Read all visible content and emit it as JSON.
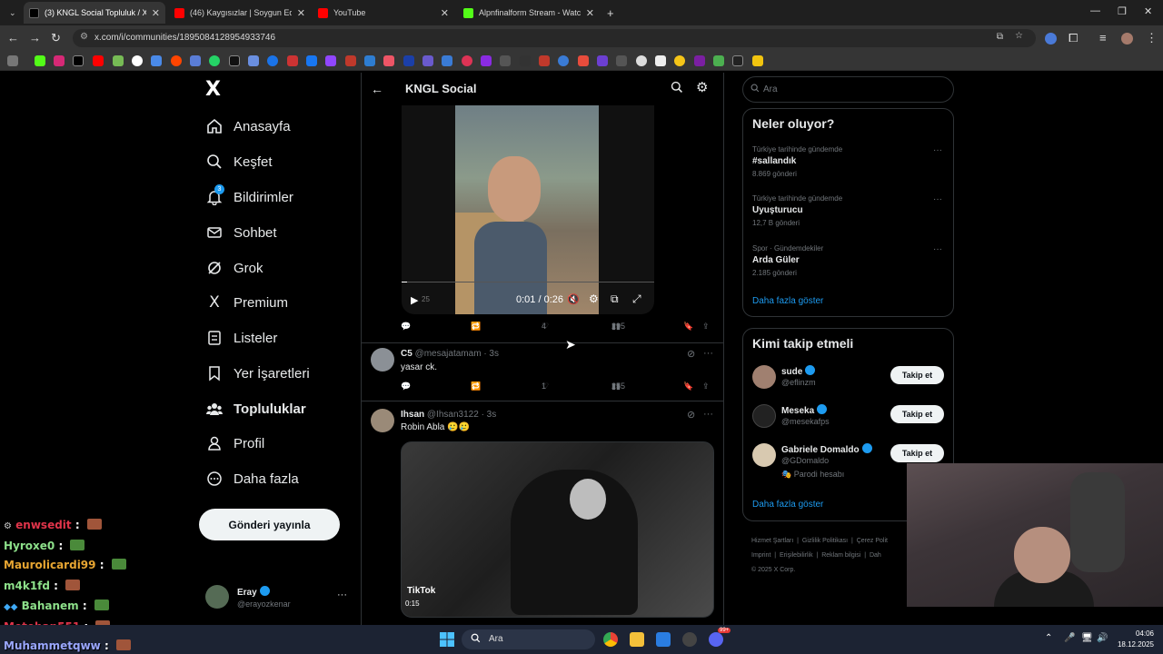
{
  "browser": {
    "tabs": [
      {
        "title": "(3) KNGL Social Topluluk / X",
        "active": true
      },
      {
        "title": "(46) Kaygısızlar | Soygun Edit - Y",
        "active": false
      },
      {
        "title": "YouTube",
        "active": false
      },
      {
        "title": "Alpnfinalform Stream - Watch L",
        "active": false
      }
    ],
    "url": "x.com/i/communities/1895084128954933746",
    "new_tab": "+"
  },
  "nav": {
    "logo": "X",
    "items": [
      {
        "label": "Anasayfa",
        "icon": "home-icon"
      },
      {
        "label": "Keşfet",
        "icon": "search-icon"
      },
      {
        "label": "Bildirimler",
        "icon": "bell-icon",
        "badge": "3"
      },
      {
        "label": "Sohbet",
        "icon": "mail-icon"
      },
      {
        "label": "Grok",
        "icon": "grok-icon"
      },
      {
        "label": "Premium",
        "icon": "x-premium-icon"
      },
      {
        "label": "Listeler",
        "icon": "list-icon"
      },
      {
        "label": "Yer İşaretleri",
        "icon": "bookmark-icon"
      },
      {
        "label": "Topluluklar",
        "icon": "communities-icon"
      },
      {
        "label": "Profil",
        "icon": "profile-icon"
      },
      {
        "label": "Daha fazla",
        "icon": "more-circle-icon"
      }
    ],
    "post_button": "Gönderi yayınla",
    "account": {
      "name": "Eray",
      "handle": "@erayozkenar",
      "more": "···"
    }
  },
  "feed": {
    "header_title": "KNGL Social",
    "video1": {
      "time": "0:01 / 0:26",
      "counter_left": "25"
    },
    "post0_actions": {
      "likes": "4",
      "views": "295"
    },
    "post1": {
      "name": "C5",
      "handle": "@mesajatamam",
      "time": "3s",
      "text": "yasar ck.",
      "likes": "1",
      "views": "255"
    },
    "post2": {
      "name": "Ihsan",
      "handle": "@Ihsan3122",
      "time": "3s",
      "text": "Robin Abla 🥲🥲",
      "tiktok": "TikTok",
      "duration": "0:15"
    }
  },
  "right": {
    "search_placeholder": "Ara",
    "trends_title": "Neler oluyor?",
    "trends": [
      {
        "context": "Türkiye tarihinde gündemde",
        "name": "#sallandık",
        "count": "8.869 gönderi"
      },
      {
        "context": "Türkiye tarihinde gündemde",
        "name": "Uyuşturucu",
        "count": "12,7 B gönderi"
      },
      {
        "context": "Spor · Gündemdekiler",
        "name": "Arda Güler",
        "count": "2.185 gönderi"
      }
    ],
    "show_more": "Daha fazla göster",
    "follow_title": "Kimi takip etmeli",
    "follow": [
      {
        "name": "sude",
        "handle": "@eflinzm",
        "extra": ""
      },
      {
        "name": "Meseka",
        "handle": "@mesekafps",
        "extra": ""
      },
      {
        "name": "Gabriele Domaldo",
        "handle": "@GDomaldo",
        "extra": "Parodi hesabı"
      }
    ],
    "follow_button": "Takip et",
    "footer": [
      "Hizmet Şartları",
      "Gizlilik Politikası",
      "Çerez Polit",
      "Imprint",
      "Erişilebilirlik",
      "Reklam bilgisi",
      "Dah",
      "© 2025 X Corp."
    ]
  },
  "chat": [
    {
      "user": "enwsedit",
      "color": "#e0344a"
    },
    {
      "user": "Hyroxe0",
      "color": "#8de08a"
    },
    {
      "user": "Maurolicardi99",
      "color": "#e8a632"
    },
    {
      "user": "m4k1fd",
      "color": "#8de08a"
    },
    {
      "user": "Bahanem",
      "color": "#8de08a"
    },
    {
      "user": "Metehan551",
      "color": "#e0344a"
    },
    {
      "user": "Muhammetqww",
      "color": "#9aa7ff"
    }
  ],
  "taskbar": {
    "search": "Ara",
    "time": "04:06",
    "date": "18.12.2025",
    "badge": "99+"
  }
}
